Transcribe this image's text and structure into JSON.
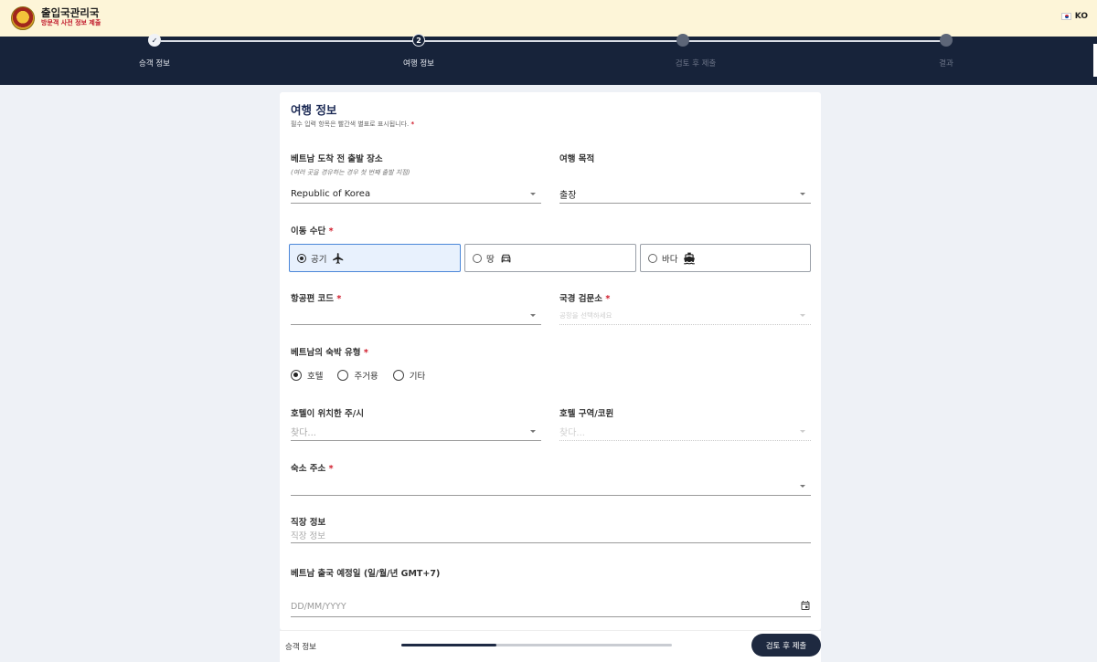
{
  "header": {
    "title": "출입국관리국",
    "subtitle": "방문객 사전 정보 제출",
    "language": "KO"
  },
  "stepper": {
    "steps": [
      {
        "label": "승객 정보",
        "state": "done",
        "mark": "✓"
      },
      {
        "label": "여행 정보",
        "state": "active",
        "mark": "2"
      },
      {
        "label": "검토 후 제출",
        "state": "pending",
        "mark": "3"
      },
      {
        "label": "결과",
        "state": "pending",
        "mark": "4"
      }
    ]
  },
  "form": {
    "title": "여행 정보",
    "required_note": "필수 입력 항목은 빨간색 별표로 표시됩니다.",
    "required_mark": "*",
    "departure": {
      "label": "베트남 도착 전 출발 장소",
      "hint": "(여러 곳을 경유하는 경우 첫 번째 출발 지점)",
      "value": "Republic of Korea"
    },
    "purpose": {
      "label": "여행 목적",
      "value": "출장"
    },
    "transport": {
      "label": "이동 수단",
      "options": [
        {
          "label": "공기",
          "icon": "airplane-icon",
          "selected": true
        },
        {
          "label": "땅",
          "icon": "car-icon",
          "selected": false
        },
        {
          "label": "바다",
          "icon": "ship-icon",
          "selected": false
        }
      ]
    },
    "flight_code": {
      "label": "항공편 코드",
      "value": ""
    },
    "border_gate": {
      "label": "국경 검문소",
      "placeholder": "공항을 선택하세요"
    },
    "accommodation_type": {
      "label": "베트남의 숙박 유형",
      "options": [
        {
          "label": "호텔",
          "selected": true
        },
        {
          "label": "주거용",
          "selected": false
        },
        {
          "label": "기타",
          "selected": false
        }
      ]
    },
    "hotel_province": {
      "label": "호텔이 위치한 주/시",
      "placeholder": "찾다..."
    },
    "hotel_district": {
      "label": "호텔 구역/코뮌",
      "placeholder": "찾다..."
    },
    "address": {
      "label": "숙소 주소",
      "value": ""
    },
    "workplace": {
      "label": "직장 정보",
      "placeholder": "직장 정보"
    },
    "exit_date": {
      "label": "베트남 출국 예정일 (일/월/년 GMT+7)",
      "placeholder": "DD/MM/YYYY"
    }
  },
  "bottom": {
    "back_label": "승객 정보",
    "progress": 0.35,
    "submit_label": "검토 후 제출"
  }
}
